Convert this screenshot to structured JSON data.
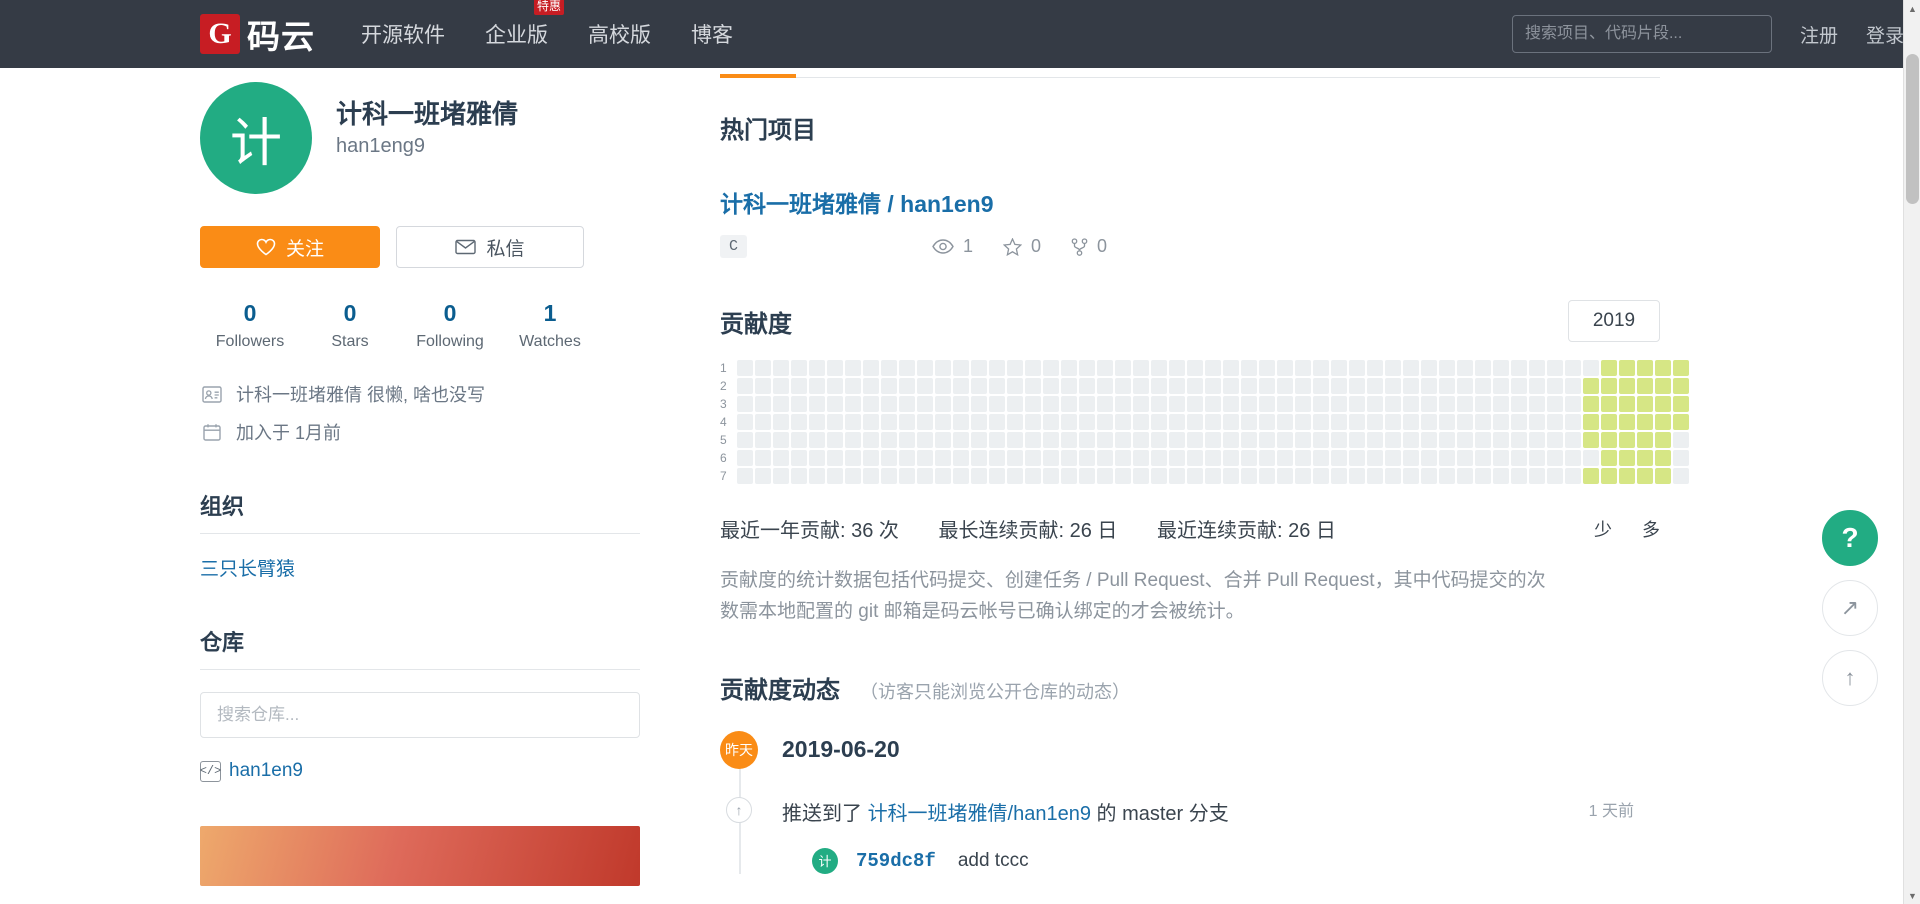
{
  "header": {
    "logo_mark": "G",
    "logo_text": "码云",
    "nav": [
      {
        "label": "开源软件",
        "badge": null
      },
      {
        "label": "企业版",
        "badge": "特惠"
      },
      {
        "label": "高校版",
        "badge": null
      },
      {
        "label": "博客",
        "badge": null
      }
    ],
    "search_placeholder": "搜索项目、代码片段...",
    "search_value": "",
    "register": "注册",
    "login": "登录"
  },
  "profile": {
    "avatar_text": "计",
    "name": "计科一班堵雅倩",
    "login": "han1eng9",
    "follow_button": "关注",
    "message_button": "私信",
    "stats": [
      {
        "value": "0",
        "label": "Followers"
      },
      {
        "value": "0",
        "label": "Stars"
      },
      {
        "value": "0",
        "label": "Following"
      },
      {
        "value": "1",
        "label": "Watches"
      }
    ],
    "bio": "计科一班堵雅倩 很懒, 啥也没写",
    "joined": "加入于 1月前"
  },
  "sidebar": {
    "org_title": "组织",
    "orgs": [
      "三只长臂猿"
    ],
    "repo_title": "仓库",
    "repo_search_placeholder": "搜索仓库...",
    "repo_search_value": "",
    "repos": [
      {
        "name": "han1en9",
        "icon": "code-icon"
      }
    ]
  },
  "content": {
    "popular_title": "热门项目",
    "repo": {
      "full_name": "计科一班堵雅倩 / han1en9",
      "language": "C",
      "watchers": "1",
      "stars": "0",
      "forks": "0"
    },
    "contrib_title": "贡献度",
    "year": "2019",
    "day_labels": [
      "1",
      "2",
      "3",
      "4",
      "5",
      "6",
      "7"
    ],
    "stats_line": [
      "最近一年贡献: 36 次",
      "最长连续贡献: 26 日",
      "最近连续贡献: 26 日"
    ],
    "legend_less": "少",
    "legend_more": "多",
    "legend_colors": [
      "#eceff1",
      "#d6e685",
      "#8cc665",
      "#44a340",
      "#1e6823"
    ],
    "contrib_desc": "贡献度的统计数据包括代码提交、创建任务 / Pull Request、合并 Pull Request，其中代码提交的次数需本地配置的 git 邮箱是码云帐号已确认绑定的才会被统计。",
    "activity_title": "贡献度动态",
    "activity_note": "（访客只能浏览公开仓库的动态）",
    "activity": {
      "badge": "昨天",
      "date": "2019-06-20",
      "event_prefix": "推送到了 ",
      "event_repo": "计科一班堵雅倩/han1en9",
      "event_suffix": " 的 master 分支",
      "relative_time": "1 天前",
      "commit_avatar": "计",
      "commit_sha": "759dc8f",
      "commit_message": "add tccc"
    }
  },
  "float_buttons": [
    {
      "icon": "help-icon",
      "glyph": "?"
    },
    {
      "icon": "share-icon",
      "glyph": "↗"
    },
    {
      "icon": "back-to-top-icon",
      "glyph": "↑"
    }
  ],
  "chart_data": {
    "type": "heatmap",
    "title": "贡献度",
    "year": "2019",
    "rows": 7,
    "columns": 53,
    "row_labels": [
      "1",
      "2",
      "3",
      "4",
      "5",
      "6",
      "7"
    ],
    "colors": [
      "#eceff1",
      "#d6e685",
      "#8cc665",
      "#44a340",
      "#1e6823"
    ],
    "legend": {
      "less": "少",
      "more": "多",
      "position": "bottom-right"
    },
    "total_contributions": 36,
    "longest_streak_days": 26,
    "current_streak_days": 26,
    "active_cells": [
      {
        "row": 0,
        "cols": [
          48,
          49,
          50,
          51,
          52
        ]
      },
      {
        "row": 1,
        "cols": [
          47,
          48,
          49,
          50,
          51,
          52
        ]
      },
      {
        "row": 2,
        "cols": [
          47,
          48,
          49,
          50,
          51,
          52
        ]
      },
      {
        "row": 3,
        "cols": [
          47,
          48,
          49,
          50,
          51,
          52
        ]
      },
      {
        "row": 4,
        "cols": [
          47,
          48,
          49,
          50,
          51
        ]
      },
      {
        "row": 5,
        "cols": [
          48,
          49,
          50,
          51
        ]
      },
      {
        "row": 6,
        "cols": [
          47,
          48,
          49,
          50,
          51
        ]
      }
    ],
    "active_level": 1
  }
}
